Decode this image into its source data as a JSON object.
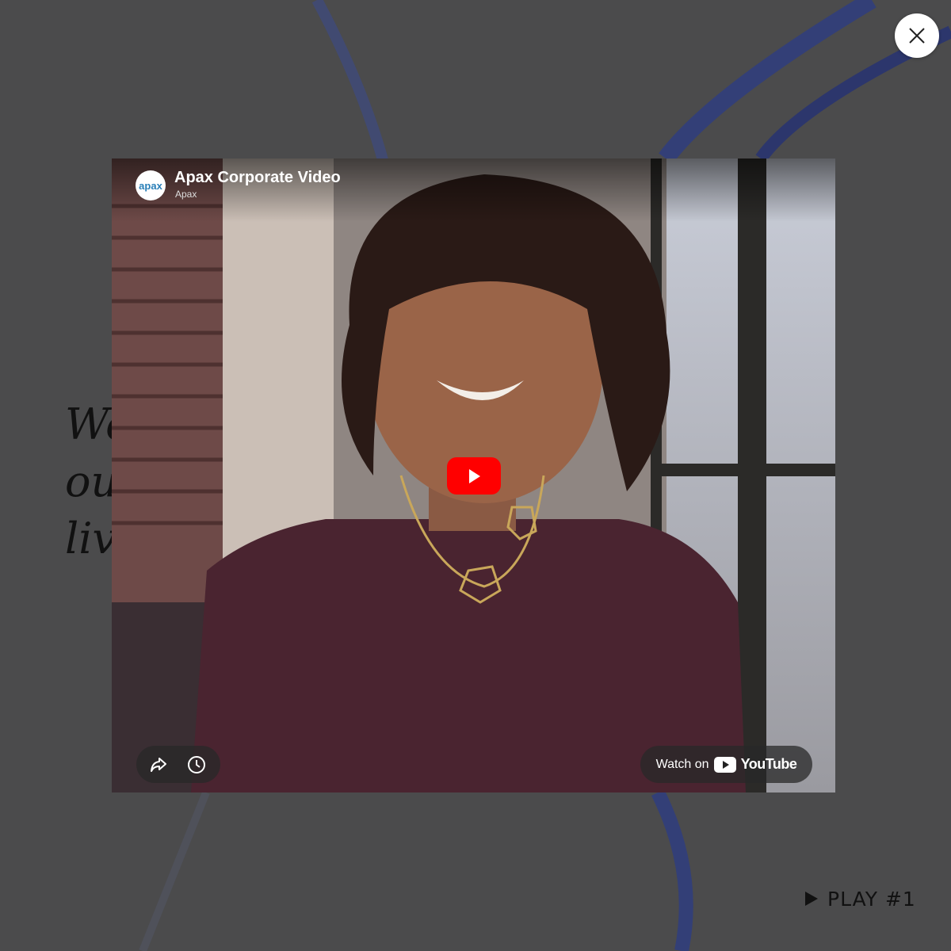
{
  "background": {
    "heading_fragments": [
      "We",
      "ou",
      "liv"
    ]
  },
  "close_button": {
    "label": "×"
  },
  "video": {
    "title": "Apax Corporate Video",
    "channel": "Apax",
    "channel_logo_text": "apax",
    "watch_on_label": "Watch on",
    "youtube_label": "YouTube",
    "icons": [
      "share-icon",
      "watch-later-icon",
      "play-icon",
      "youtube-logo-icon"
    ],
    "brand_color": "#ff0000"
  },
  "play_link": {
    "label": "PLAY #1"
  }
}
